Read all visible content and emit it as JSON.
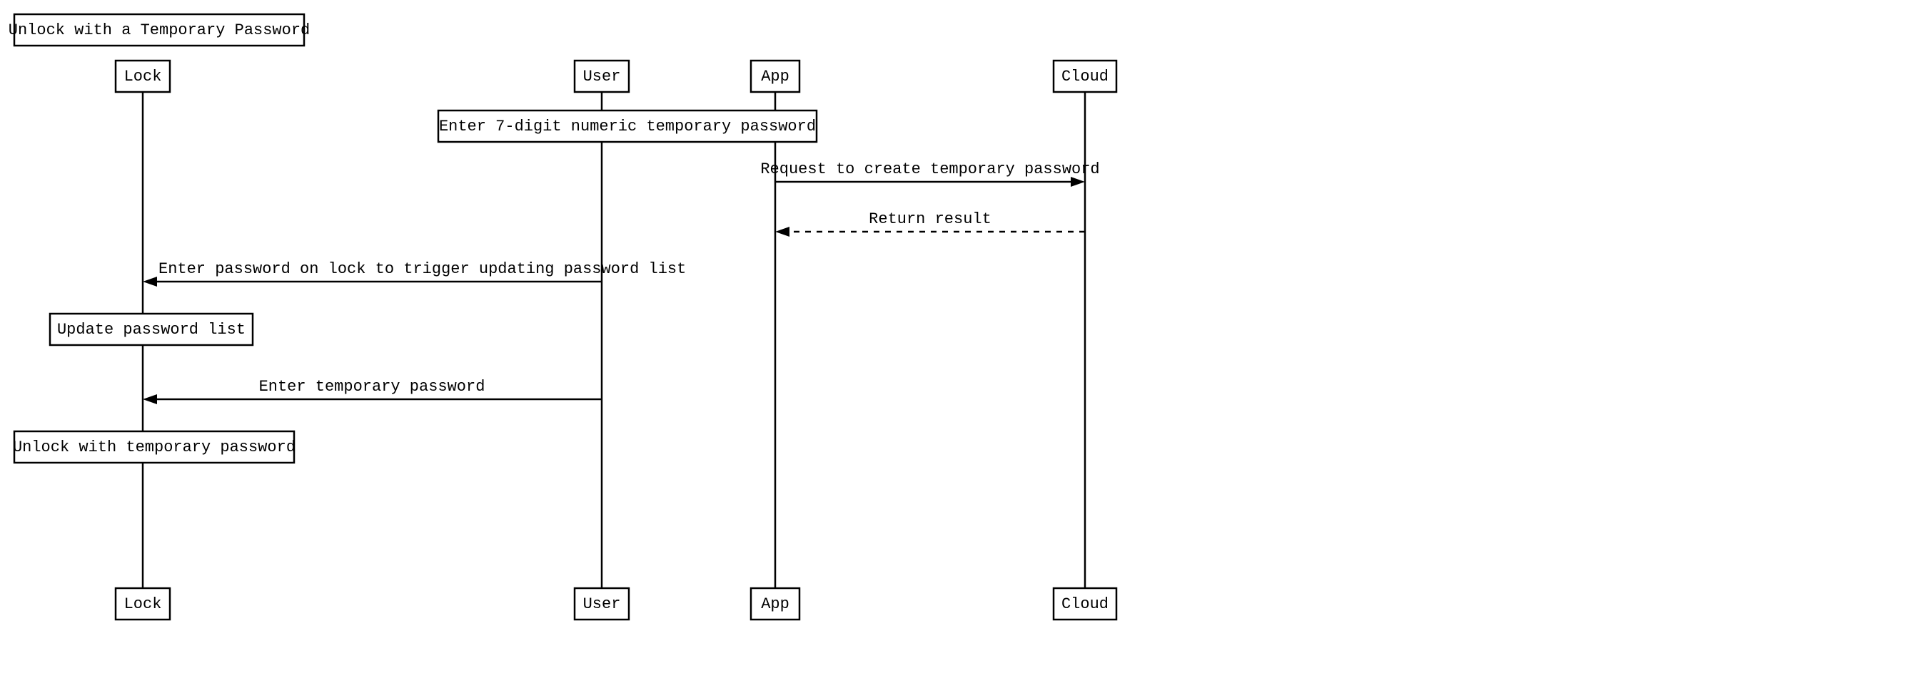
{
  "diagram": {
    "title": "Unlock with a Temporary Password",
    "participants": {
      "lock": "Lock",
      "user": "User",
      "app": "App",
      "cloud": "Cloud"
    },
    "notes": {
      "enter_7digit": "Enter 7-digit numeric temporary password",
      "update_list": "Update password list",
      "unlock_temp": "Unlock with temporary password"
    },
    "messages": {
      "request_create": "Request to create temporary password",
      "return_result": "Return result",
      "trigger_update": "Enter password on lock to trigger updating password list",
      "enter_temp": "Enter temporary password"
    }
  }
}
